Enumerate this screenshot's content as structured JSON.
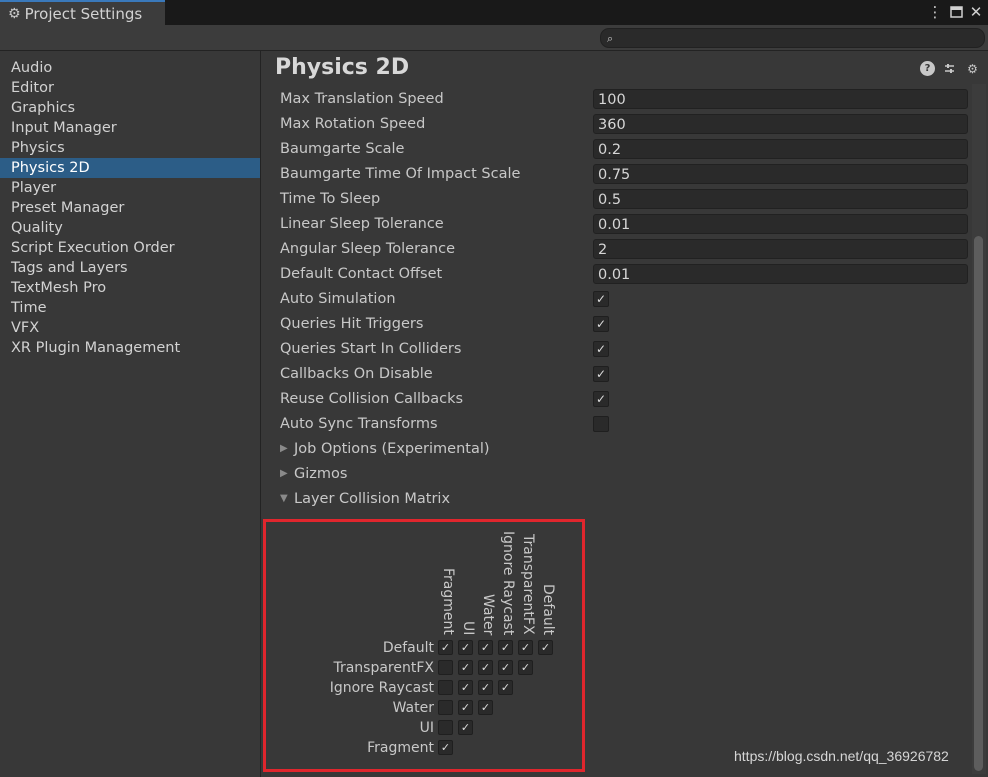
{
  "window": {
    "tab_title": "Project Settings",
    "tab_icon": "gear-icon"
  },
  "search": {
    "value": ""
  },
  "sidebar": {
    "items": [
      {
        "label": "Audio"
      },
      {
        "label": "Editor"
      },
      {
        "label": "Graphics"
      },
      {
        "label": "Input Manager"
      },
      {
        "label": "Physics"
      },
      {
        "label": "Physics 2D",
        "active": true
      },
      {
        "label": "Player"
      },
      {
        "label": "Preset Manager"
      },
      {
        "label": "Quality"
      },
      {
        "label": "Script Execution Order"
      },
      {
        "label": "Tags and Layers"
      },
      {
        "label": "TextMesh Pro"
      },
      {
        "label": "Time"
      },
      {
        "label": "VFX"
      },
      {
        "label": "XR Plugin Management"
      }
    ]
  },
  "main": {
    "title": "Physics 2D",
    "fields": [
      {
        "label": "Max Translation Speed",
        "value": "100"
      },
      {
        "label": "Max Rotation Speed",
        "value": "360"
      },
      {
        "label": "Baumgarte Scale",
        "value": "0.2"
      },
      {
        "label": "Baumgarte Time Of Impact Scale",
        "value": "0.75"
      },
      {
        "label": "Time To Sleep",
        "value": "0.5"
      },
      {
        "label": "Linear Sleep Tolerance",
        "value": "0.01"
      },
      {
        "label": "Angular Sleep Tolerance",
        "value": "2"
      },
      {
        "label": "Default Contact Offset",
        "value": "0.01"
      }
    ],
    "toggles": [
      {
        "label": "Auto Simulation",
        "checked": true
      },
      {
        "label": "Queries Hit Triggers",
        "checked": true
      },
      {
        "label": "Queries Start In Colliders",
        "checked": true
      },
      {
        "label": "Callbacks On Disable",
        "checked": true
      },
      {
        "label": "Reuse Collision Callbacks",
        "checked": true
      },
      {
        "label": "Auto Sync Transforms",
        "checked": false
      }
    ],
    "foldouts": [
      {
        "label": "Job Options (Experimental)",
        "expanded": false
      },
      {
        "label": "Gizmos",
        "expanded": false
      },
      {
        "label": "Layer Collision Matrix",
        "expanded": true
      }
    ]
  },
  "matrix": {
    "columns": [
      "Fragment",
      "UI",
      "Water",
      "Ignore Raycast",
      "TransparentFX",
      "Default"
    ],
    "rows": [
      {
        "label": "Default",
        "cells": [
          true,
          true,
          true,
          true,
          true,
          true
        ]
      },
      {
        "label": "TransparentFX",
        "cells": [
          false,
          true,
          true,
          true,
          true
        ]
      },
      {
        "label": "Ignore Raycast",
        "cells": [
          false,
          true,
          true,
          true
        ]
      },
      {
        "label": "Water",
        "cells": [
          false,
          true,
          true
        ]
      },
      {
        "label": "UI",
        "cells": [
          false,
          true
        ]
      },
      {
        "label": "Fragment",
        "cells": [
          true
        ]
      }
    ]
  },
  "watermark": "https://blog.csdn.net/qq_36926782",
  "colors": {
    "accent": "#2c5d87",
    "highlight_box": "#e0262d",
    "tab_line": "#3a79bb"
  }
}
